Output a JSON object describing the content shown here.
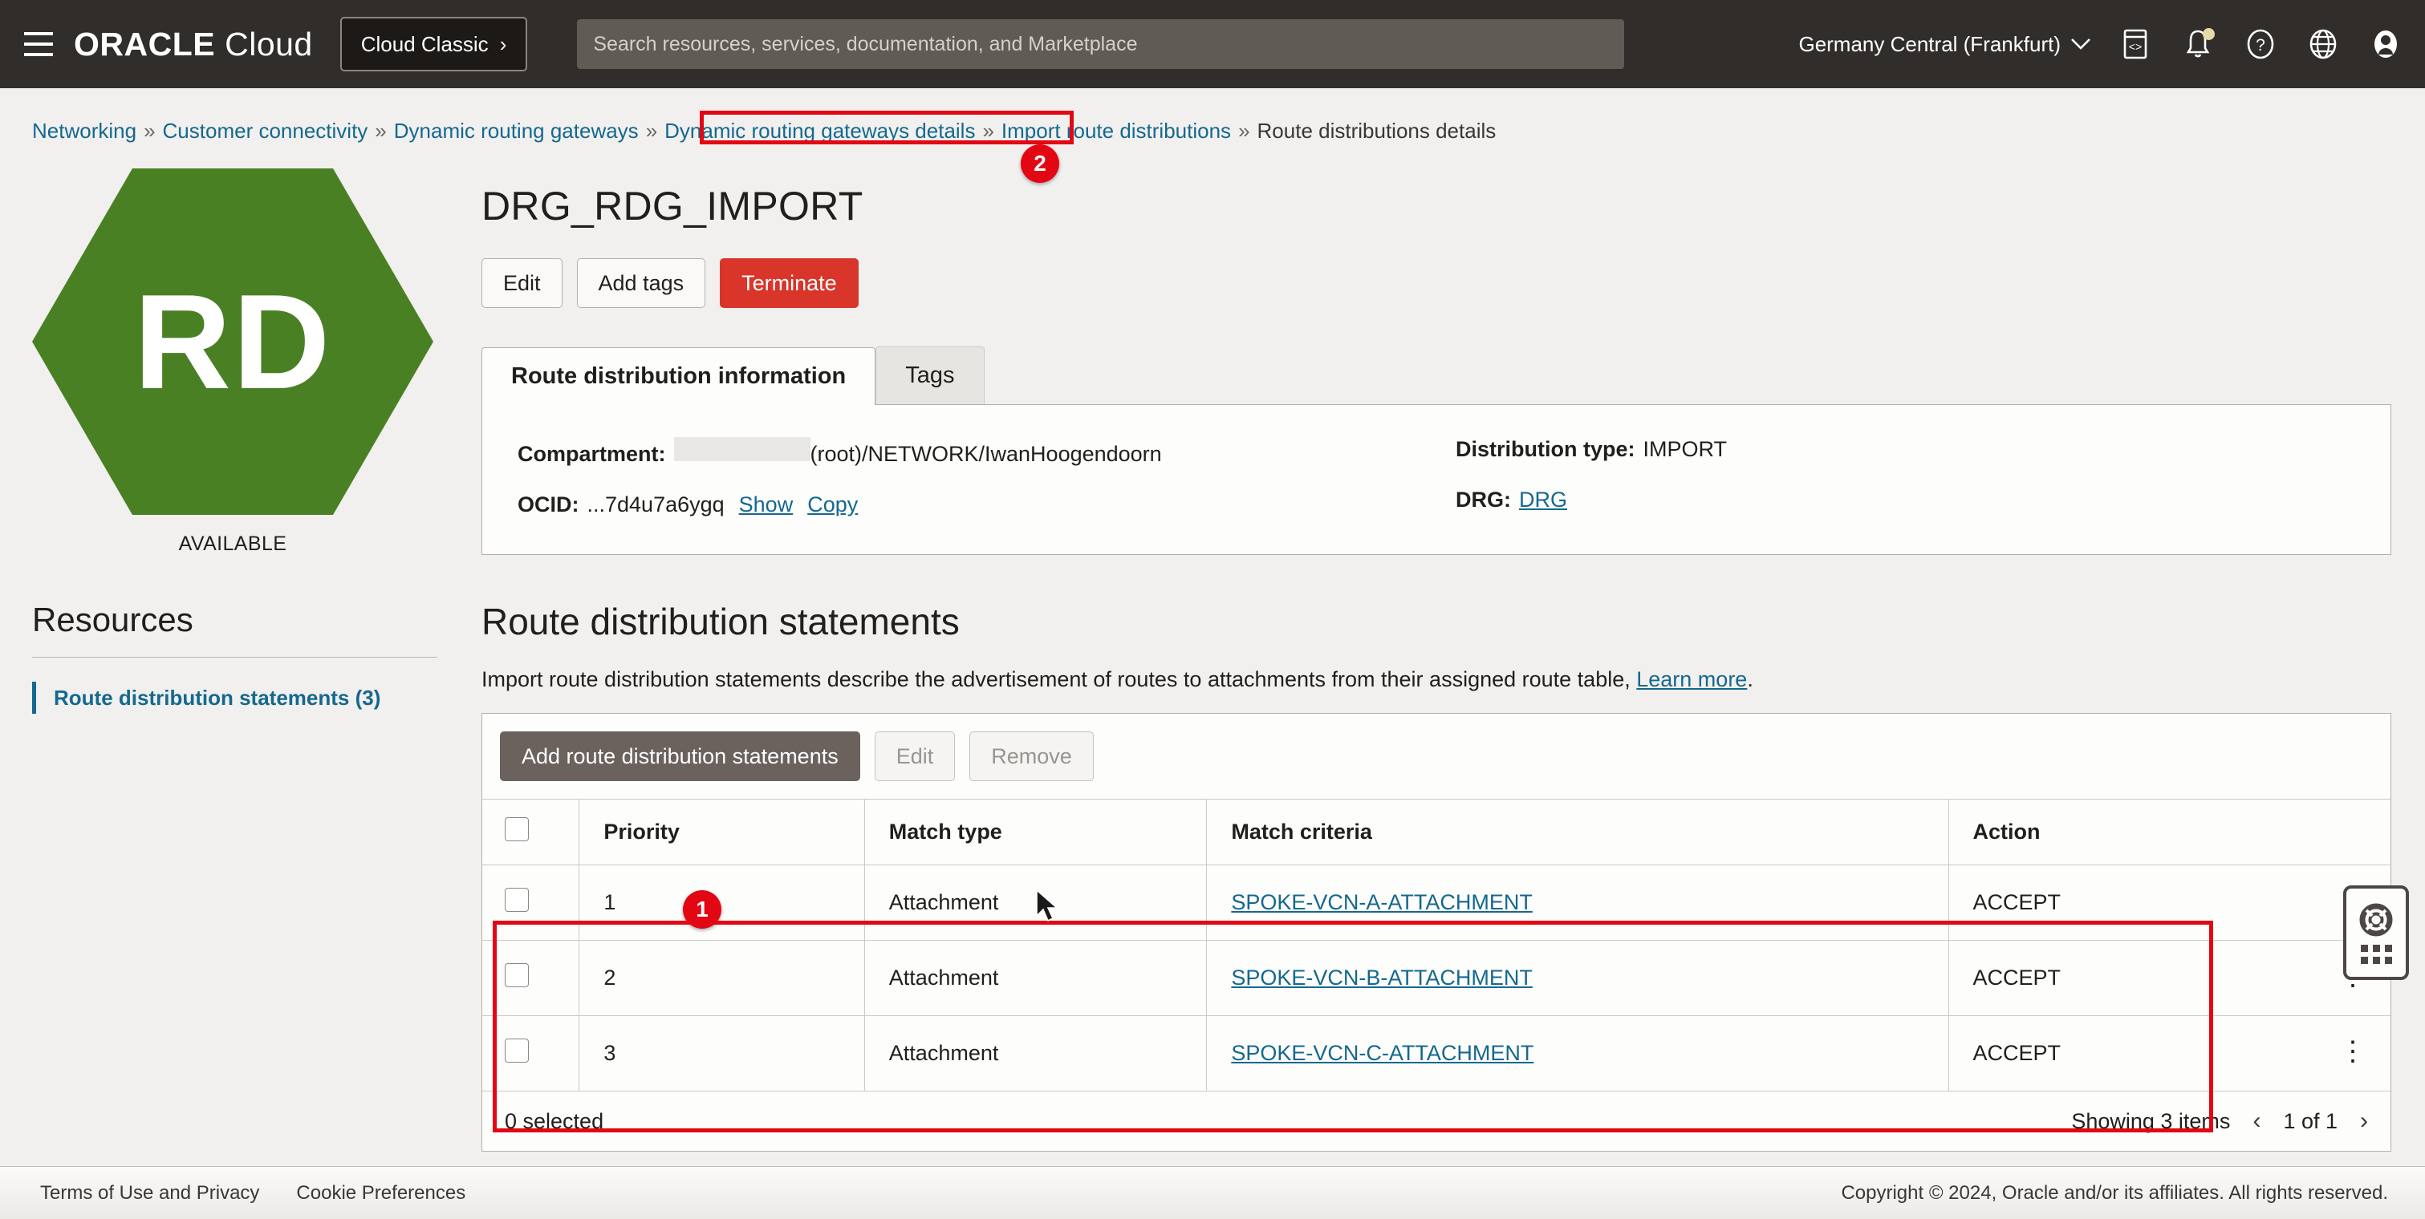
{
  "topbar": {
    "menu_icon": "hamburger-icon",
    "brand_primary": "ORACLE",
    "brand_secondary": "Cloud",
    "cloud_classic_label": "Cloud Classic",
    "cloud_classic_chevron": "›",
    "search_placeholder": "Search resources, services, documentation, and Marketplace",
    "search_value": "",
    "region": "Germany Central (Frankfurt)",
    "region_chevron": "∨",
    "icons": [
      "code-editor-icon",
      "notifications-bell-icon",
      "help-question-icon",
      "language-globe-icon",
      "user-avatar-icon"
    ],
    "background": "#312d2a"
  },
  "breadcrumb": {
    "items": [
      {
        "label": "Networking",
        "link": true
      },
      {
        "label": "Customer connectivity",
        "link": true
      },
      {
        "label": "Dynamic routing gateways",
        "link": true
      },
      {
        "label": "Dynamic routing gateways details",
        "link": true
      },
      {
        "label": "Import route distributions",
        "link": true
      },
      {
        "label": "Route distributions details",
        "link": false
      }
    ],
    "separator": "»"
  },
  "callouts": [
    {
      "id": "1",
      "label": "1"
    },
    {
      "id": "2",
      "label": "2"
    }
  ],
  "resource_card": {
    "initials": "RD",
    "status": "AVAILABLE",
    "hex_color": "#4a8024"
  },
  "sidebar": {
    "title": "Resources",
    "items": [
      {
        "label": "Route distribution statements (3)",
        "active": true
      }
    ]
  },
  "page": {
    "title": "DRG_RDG_IMPORT",
    "buttons": [
      {
        "label": "Edit",
        "style": "secondary"
      },
      {
        "label": "Add tags",
        "style": "secondary"
      },
      {
        "label": "Terminate",
        "style": "danger"
      }
    ]
  },
  "tabs": [
    {
      "label": "Route distribution information",
      "active": true
    },
    {
      "label": "Tags",
      "active": false
    }
  ],
  "info_panel": {
    "left": [
      {
        "label": "Compartment:",
        "value": "(root)/NETWORK/IwanHoogendoorn",
        "redacted": true
      },
      {
        "label": "OCID:",
        "value": "...7d4u7a6ygq",
        "actions": [
          "Show",
          "Copy"
        ]
      }
    ],
    "right": [
      {
        "label": "Distribution type:",
        "value": "IMPORT"
      },
      {
        "label": "DRG:",
        "value": "DRG",
        "link": true
      }
    ],
    "ocid_show": "Show",
    "ocid_copy": "Copy"
  },
  "section": {
    "title": "Route distribution statements",
    "description_prefix": "Import route distribution statements describe the advertisement of routes to attachments from their assigned route table,",
    "description_link": "Learn more",
    "description_suffix": "."
  },
  "table": {
    "toolbar": [
      {
        "label": "Add route distribution statements",
        "style": "primary-dark",
        "disabled": false
      },
      {
        "label": "Edit",
        "style": "secondary",
        "disabled": true
      },
      {
        "label": "Remove",
        "style": "secondary",
        "disabled": true
      }
    ],
    "columns": [
      "Priority",
      "Match type",
      "Match criteria",
      "Action"
    ],
    "rows": [
      {
        "priority": "1",
        "match_type": "Attachment",
        "match_criteria": "SPOKE-VCN-A-ATTACHMENT",
        "action": "ACCEPT"
      },
      {
        "priority": "2",
        "match_type": "Attachment",
        "match_criteria": "SPOKE-VCN-B-ATTACHMENT",
        "action": "ACCEPT"
      },
      {
        "priority": "3",
        "match_type": "Attachment",
        "match_criteria": "SPOKE-VCN-C-ATTACHMENT",
        "action": "ACCEPT"
      }
    ],
    "selected_text": "0 selected",
    "showing_text": "Showing 3 items",
    "page_text": "1 of 1",
    "prev_arrow": "‹",
    "next_arrow": "›",
    "kebab_glyph": "⋮"
  },
  "help_widget": {
    "icon": "lifebuoy-icon",
    "drag_handle": "grid-drag-handle-icon"
  },
  "footer": {
    "links": [
      "Terms of Use and Privacy",
      "Cookie Preferences"
    ],
    "copyright": "Copyright © 2024, Oracle and/or its affiliates. All rights reserved."
  },
  "colors": {
    "link": "#15688f",
    "danger": "#d9352a",
    "callout": "#e30613",
    "green": "#4a8024",
    "topbar": "#312d2a"
  }
}
